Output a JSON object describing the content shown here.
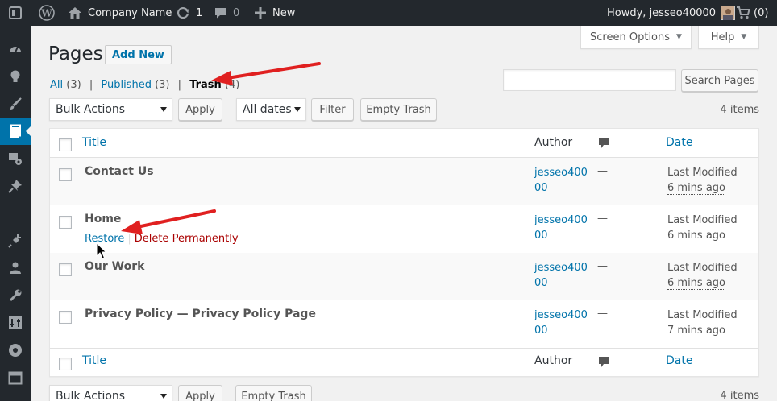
{
  "admin_bar": {
    "site_name": "Company Name",
    "updates_count": "1",
    "comments_count": "0",
    "new_label": "New",
    "greeting": "Howdy, jesseo40000",
    "cart_count": "(0)"
  },
  "tabs": {
    "screen_options": "Screen Options",
    "help": "Help"
  },
  "page": {
    "title": "Pages",
    "add_new": "Add New"
  },
  "filters": {
    "all_label": "All",
    "all_count": "(3)",
    "published_label": "Published",
    "published_count": "(3)",
    "trash_label": "Trash",
    "trash_count": "(4)",
    "separator": "|"
  },
  "search": {
    "placeholder": "",
    "button": "Search Pages"
  },
  "toolbar": {
    "bulk_actions": "Bulk Actions",
    "apply": "Apply",
    "dates": "All dates",
    "filter": "Filter",
    "empty_trash": "Empty Trash",
    "items_count": "4 items"
  },
  "table": {
    "headers": {
      "title": "Title",
      "author": "Author",
      "date": "Date"
    },
    "rows": [
      {
        "title": "Contact Us",
        "author": "jesseo40000",
        "comments": "—",
        "date_label": "Last Modified",
        "date_ago": "6 mins ago"
      },
      {
        "title": "Home",
        "author": "jesseo40000",
        "comments": "—",
        "date_label": "Last Modified",
        "date_ago": "6 mins ago",
        "actions": {
          "restore": "Restore",
          "delete": "Delete Permanently"
        }
      },
      {
        "title": "Our Work",
        "author": "jesseo40000",
        "comments": "—",
        "date_label": "Last Modified",
        "date_ago": "6 mins ago"
      },
      {
        "title": "Privacy Policy — Privacy Policy Page",
        "author": "jesseo40000",
        "comments": "—",
        "date_label": "Last Modified",
        "date_ago": "7 mins ago"
      }
    ]
  },
  "bottom_toolbar": {
    "bulk_actions": "Bulk Actions",
    "apply": "Apply",
    "empty_trash": "Empty Trash",
    "items_count": "4 items"
  },
  "colors": {
    "admin_bar": "#23282d",
    "link": "#0073aa",
    "danger": "#a00",
    "annotation_arrow": "#e02020"
  },
  "icons": {
    "wordpress": "wordpress-logo-icon",
    "home": "home-icon",
    "updates": "refresh-icon",
    "comments": "comment-bubble-icon",
    "new": "plus-icon",
    "cart": "cart-icon"
  }
}
